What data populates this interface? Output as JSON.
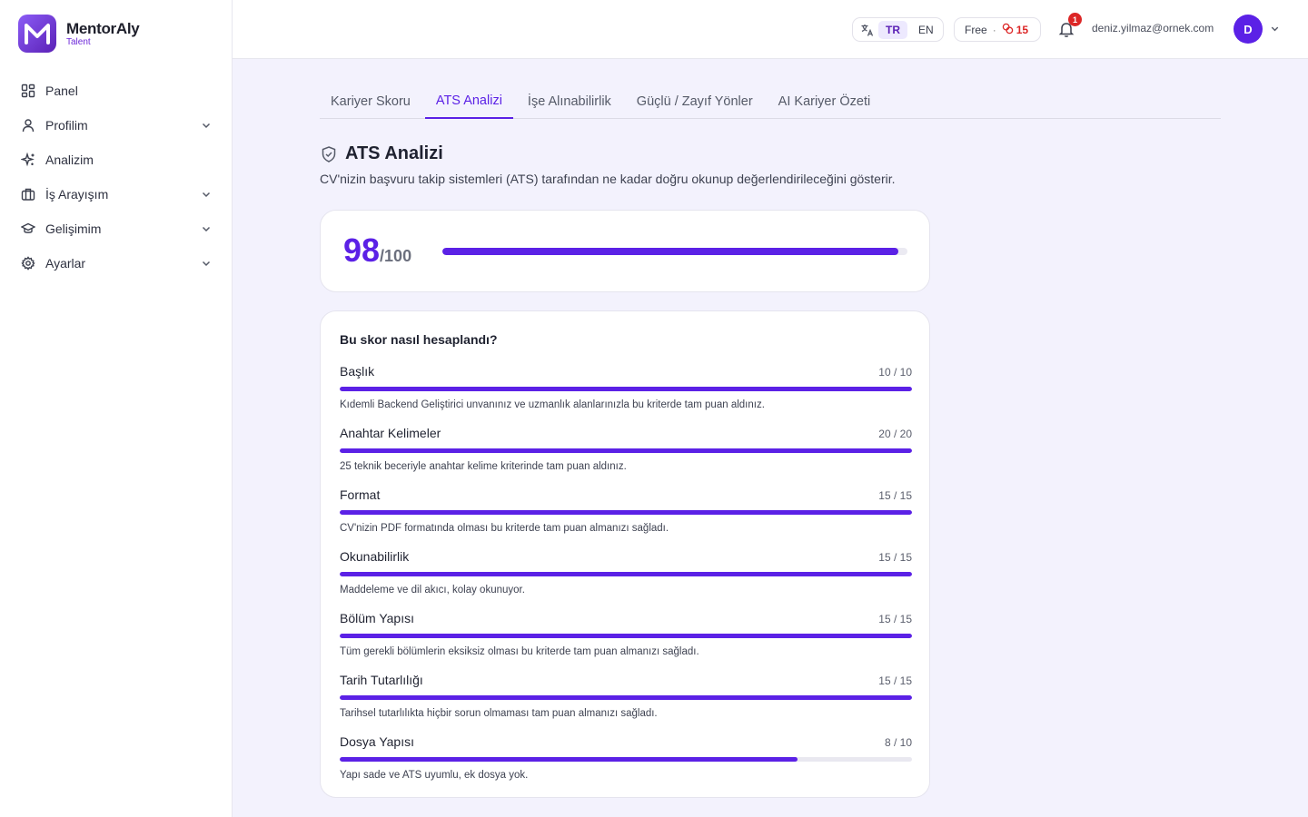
{
  "brand": {
    "name": "MentorAly",
    "sub": "Talent"
  },
  "sidebar": {
    "items": [
      {
        "label": "Panel",
        "icon": "grid-icon",
        "expandable": false
      },
      {
        "label": "Profilim",
        "icon": "user-icon",
        "expandable": true
      },
      {
        "label": "Analizim",
        "icon": "sparkle-icon",
        "expandable": false
      },
      {
        "label": "İş Arayışım",
        "icon": "briefcase-icon",
        "expandable": true
      },
      {
        "label": "Gelişimim",
        "icon": "graduation-cap-icon",
        "expandable": true
      },
      {
        "label": "Ayarlar",
        "icon": "gear-icon",
        "expandable": true
      }
    ]
  },
  "header": {
    "lang_tr": "TR",
    "lang_en": "EN",
    "plan": "Free",
    "plan_sep": "·",
    "credits": "15",
    "notifications": "1",
    "email": "deniz.yilmaz@ornek.com",
    "avatar_initial": "D"
  },
  "tabs": [
    {
      "label": "Kariyer Skoru",
      "active": false
    },
    {
      "label": "ATS Analizi",
      "active": true
    },
    {
      "label": "İşe Alınabilirlik",
      "active": false
    },
    {
      "label": "Güçlü / Zayıf Yönler",
      "active": false
    },
    {
      "label": "AI Kariyer Özeti",
      "active": false
    }
  ],
  "page": {
    "title": "ATS Analizi",
    "subtitle": "CV'nizin başvuru takip sistemleri (ATS) tarafından ne kadar doğru okunup değerlendirileceğini gösterir."
  },
  "score": {
    "value": "98",
    "max": "/100",
    "fraction": 0.98
  },
  "breakdown": {
    "title": "Bu skor nasıl hesaplandı?",
    "criteria": [
      {
        "name": "Başlık",
        "score": "10 / 10",
        "fraction": 1.0,
        "desc": "Kıdemli Backend Geliştirici unvanınız ve uzmanlık alanlarınızla bu kriterde tam puan aldınız."
      },
      {
        "name": "Anahtar Kelimeler",
        "score": "20 / 20",
        "fraction": 1.0,
        "desc": "25 teknik beceriyle anahtar kelime kriterinde tam puan aldınız."
      },
      {
        "name": "Format",
        "score": "15 / 15",
        "fraction": 1.0,
        "desc": "CV'nizin PDF formatında olması bu kriterde tam puan almanızı sağladı."
      },
      {
        "name": "Okunabilirlik",
        "score": "15 / 15",
        "fraction": 1.0,
        "desc": "Maddeleme ve dil akıcı, kolay okunuyor."
      },
      {
        "name": "Bölüm Yapısı",
        "score": "15 / 15",
        "fraction": 1.0,
        "desc": "Tüm gerekli bölümlerin eksiksiz olması bu kriterde tam puan almanızı sağladı."
      },
      {
        "name": "Tarih Tutarlılığı",
        "score": "15 / 15",
        "fraction": 1.0,
        "desc": "Tarihsel tutarlılıkta hiçbir sorun olmaması tam puan almanızı sağladı."
      },
      {
        "name": "Dosya Yapısı",
        "score": "8 / 10",
        "fraction": 0.8,
        "desc": "Yapı sade ve ATS uyumlu, ek dosya yok."
      }
    ]
  },
  "colors": {
    "accent": "#5b21e6",
    "badge": "#dc2626",
    "background": "#f3f2fd"
  }
}
